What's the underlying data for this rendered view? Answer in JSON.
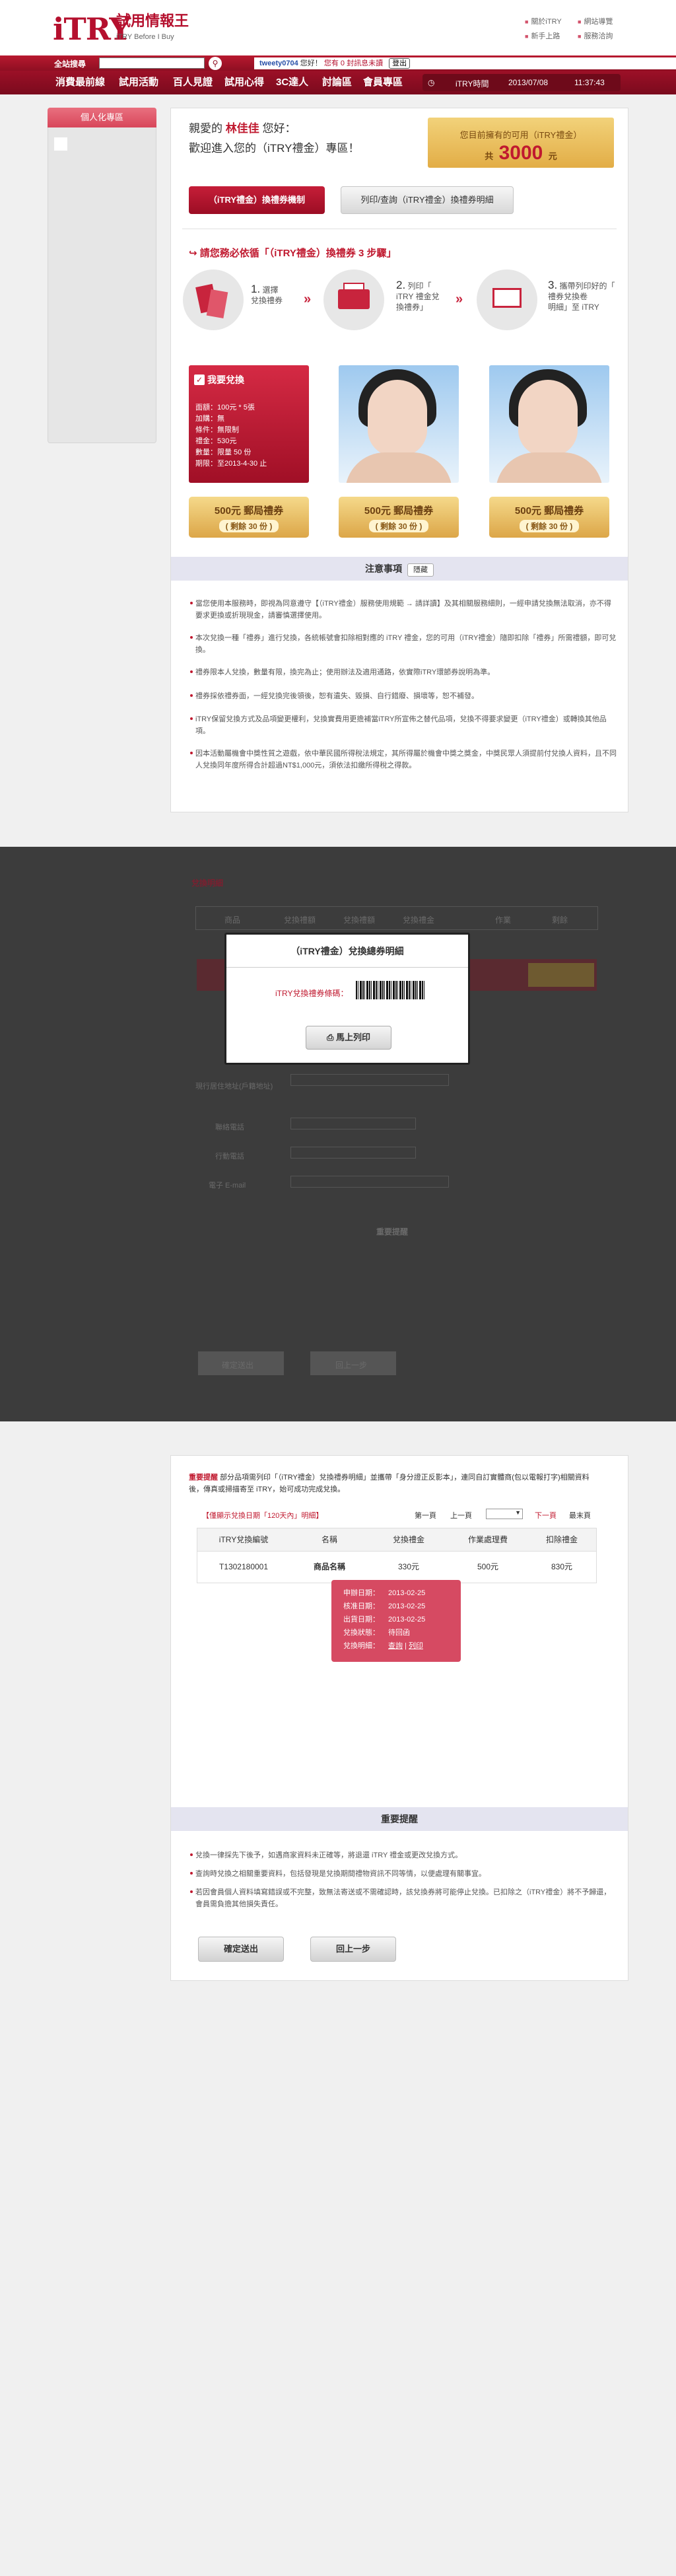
{
  "brand": {
    "logo": "iTRY",
    "site_name": "試用情報王",
    "tagline": "iTRY Before I Buy"
  },
  "top_links": {
    "about": "關於iTRY",
    "sitemap": "網站導覽",
    "newbie": "新手上路",
    "contact": "服務洽詢"
  },
  "search": {
    "label": "全站搜尋",
    "value": "",
    "button_icon": "search-icon"
  },
  "user": {
    "username": "tweety0704",
    "greeting": "您好！",
    "mail_text": "您有 0 封訊息未讀",
    "logout": "登出"
  },
  "nav": {
    "items": [
      "消費最前線",
      "試用活動",
      "百人見證",
      "試用心得",
      "3C達人",
      "討論區",
      "會員專區"
    ],
    "clock_label": "iTRY時間",
    "date": "2013/07/08",
    "time": "11:37:43"
  },
  "sidebar": {
    "title": "個人化專區"
  },
  "welcome": {
    "line1_prefix": "親愛的",
    "name": "林佳佳",
    "line1_suffix": "您好：",
    "line2": "歡迎進入您的（iTRY禮金）專區！"
  },
  "points": {
    "label": "您目前擁有的可用（iTRY禮金）",
    "prefix": "共",
    "value": "3000",
    "unit": "元"
  },
  "tabs": {
    "rules": "（iTRY禮金）換禮券機制",
    "print": "列印/查詢（iTRY禮金）換禮券明細"
  },
  "steps": {
    "title": "請您務必依循「（iTRY禮金）換禮券 3 步驟」",
    "s1": {
      "num": "1.",
      "text_a": "選擇",
      "text_b": "兌換禮券"
    },
    "s2": {
      "num": "2.",
      "text_a": "列印「",
      "text_b": "iTRY 禮金兌",
      "text_c": "換禮券」"
    },
    "s3": {
      "num": "3.",
      "text_a": "攜帶列印好的「",
      "text_b": "禮券兌換卷",
      "text_c": "明細」至 iTRY"
    }
  },
  "cards": [
    {
      "header": "我要兌換",
      "info": [
        "面額：100元 * 5張",
        "加購：無",
        "條件：無限制",
        "禮金：530元",
        "數量：限量 50 份",
        "期限：至2013-4-30 止"
      ],
      "ticket": "500元 郵局禮券",
      "ticket_sub": "( 剩餘 30 份 )"
    },
    {
      "ticket": "500元 郵局禮券",
      "ticket_sub": "( 剩餘 30 份 )"
    },
    {
      "ticket": "500元 郵局禮券",
      "ticket_sub": "( 剩餘 30 份 )"
    }
  ],
  "notice": {
    "title": "注意事項",
    "expand": "隱藏",
    "items": [
      "當您使用本服務時，即視為同意遵守【（iTRY禮金）服務使用規範 → 請詳讀】及其相關服務細則，一經申請兌換無法取消，亦不得要求更換或折現現金，請審慎選擇使用。",
      "本次兌換一種「禮券」進行兌換，各統帳號會扣除相對應的 iTRY 禮金，您的可用（iTRY禮金）隨即扣除「禮券」所需禮額，即可兌換。",
      "禮券限本人兌換，數量有限，換完為止；使用辦法及適用通路，依實際iTRY環節券說明為準。",
      "禮券採依禮券面，一經兌換完後領後，恕有遺失、毀損、自行錯廢、損壞等，恕不補發。",
      "iTRY保留兌換方式及品項變更權利，兌換實費用更擔補當iTRY所宣佈之替代品項，兌換不得要求變更（iTRY禮金）或轉換其他品項。",
      "因本活動屬機會中獎性質之遊戲，依中華民國所得稅法規定，其所得屬於機會中獎之獎金，中獎民眾人須提前付兌換人資料，且不同人兌換同年度所得合計超過NT$1,000元，須依法扣繳所得稅之得款。"
    ]
  },
  "section2": {
    "title": "兌換明細",
    "modal_title": "（iTRY禮金）兌換總券明細",
    "barcode_label": "iTRY兌換禮券條碼：",
    "print_button": "馬上列印",
    "ghost_cols": [
      "商品",
      "兌換禮額",
      "兌換禮額",
      "兌換禮金",
      "作業",
      "剩餘"
    ],
    "ghost_fields": [
      "現行居住地址(戶籍地址)",
      "聯絡電話",
      "行動電話",
      "電子 E-mail"
    ],
    "notice_title": "重要提醒",
    "confirm": "確定送出",
    "back": "回上一步"
  },
  "section3": {
    "title": "重要提醒",
    "intro": "部分品項需列印「（iTRY禮金）兌換禮券明細」並攜帶「身分證正反影本」，連同自訂實體商(包以電報打字)相關資料後，傳真或掃描寄至 iTRY，始可成功完成兌換。",
    "filter_label": "【僅顯示兌換日期「120天內」明細】",
    "first": "第一頁",
    "prev": "上一頁",
    "next": "下一頁",
    "last": "最末頁",
    "columns": [
      "iTRY兌換編號",
      "名稱",
      "兌換禮金",
      "作業處理費",
      "扣除禮金"
    ],
    "row": {
      "id": "T1302180001",
      "name": "商品名稱",
      "amount": "330元",
      "fee": "500元",
      "deduct": "830元"
    },
    "popup": {
      "labels": [
        "申辦日期：",
        "核准日期：",
        "出貨日期：",
        "兌換狀態：",
        "兌換明細："
      ],
      "values": [
        "2013-02-25",
        "2013-02-25",
        "2013-02-25",
        "待回函"
      ],
      "link_a": "查詢",
      "sep": " | ",
      "link_b": "列印"
    },
    "notice_title": "重要提醒",
    "notices": [
      "兌換一律採先下後予，如遇商家資料未正確等，將退還 iTRY 禮金或更改兌換方式。",
      "查詢時兌換之相關重要資料，包括發現是兌換期間禮物資訊不同等情，以便處理有關事宜。",
      "若因會員個人資料填寫錯誤或不完整，致無法寄送或不需確認時，該兌換券將可能停止兌換。已扣除之（iTRY禮金）將不予歸還，會員需負擔其他損失責任。"
    ],
    "confirm": "確定送出",
    "back": "回上一步"
  },
  "colors": {
    "brand_red": "#b5102e",
    "gold": "#e2ad46",
    "overlay": "#3c3c3c"
  }
}
